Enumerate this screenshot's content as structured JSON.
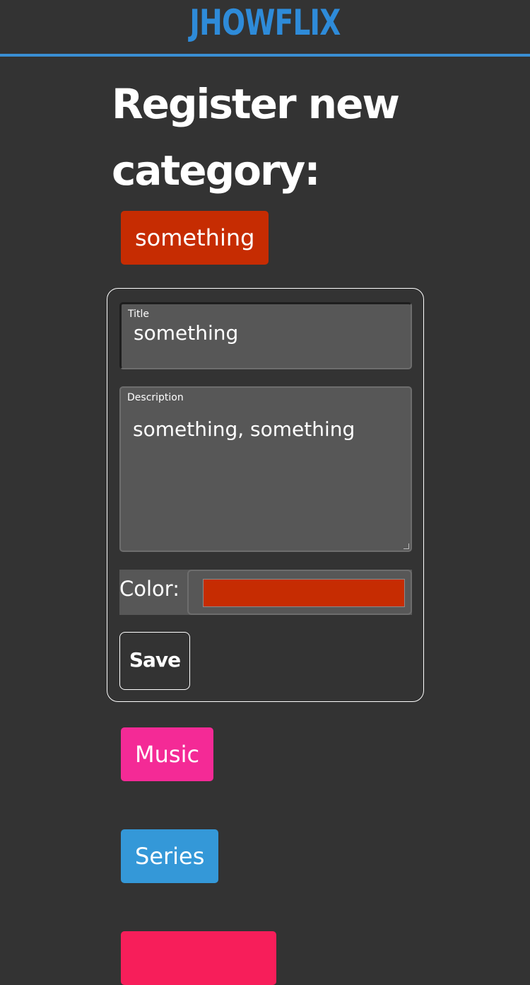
{
  "header": {
    "logo_text": "JHOWFLIX",
    "accent_color": "#3a8fd4"
  },
  "page": {
    "title": "Register new category:"
  },
  "preview_chip": {
    "label": "something",
    "color": "#c62c02"
  },
  "form": {
    "title_label": "Title",
    "title_value": "something",
    "description_label": "Description",
    "description_value": "something, something",
    "color_label": "Color:",
    "color_value": "#c62c02",
    "save_label": "Save"
  },
  "categories": [
    {
      "label": "Music",
      "color": "#f42a96"
    },
    {
      "label": "Series",
      "color": "#3498d8"
    },
    {
      "label": "",
      "color": "#f71e5a"
    }
  ]
}
